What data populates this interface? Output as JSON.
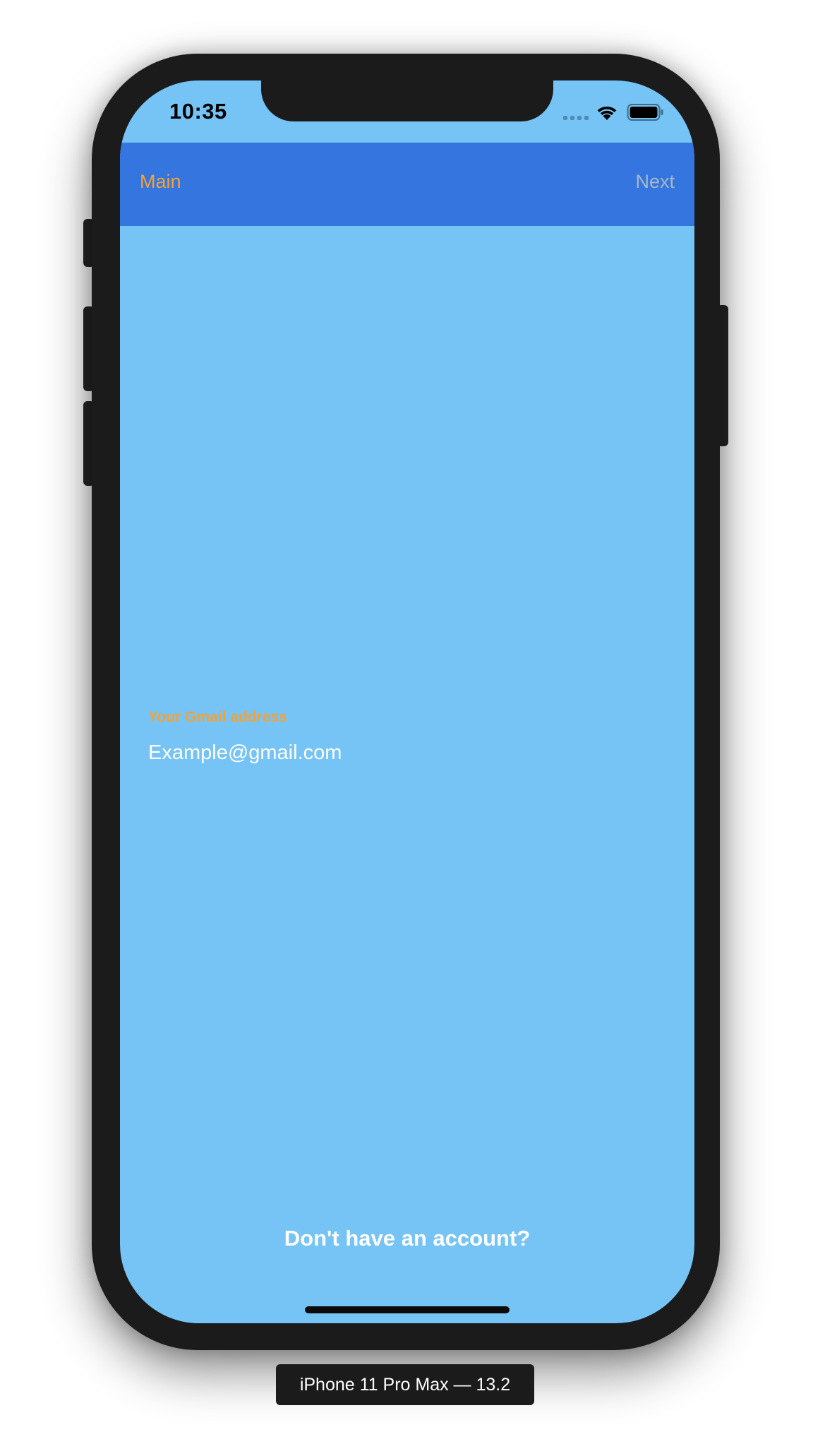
{
  "status_bar": {
    "time": "10:35",
    "wifi_icon": "wifi-icon",
    "battery_icon": "battery-icon"
  },
  "navbar": {
    "left_label": "Main",
    "right_label": "Next",
    "background": "#3575df",
    "left_color": "#f4a236",
    "right_color": "#a9b6c9"
  },
  "email_field": {
    "label": "Your Gmail address",
    "placeholder": "Example@gmail.com",
    "value": ""
  },
  "signup": {
    "label": "Don't have an account?"
  },
  "theme": {
    "screen_background": "#76c4f5",
    "accent": "#f4a236"
  },
  "device_label": "iPhone 11 Pro Max — 13.2"
}
